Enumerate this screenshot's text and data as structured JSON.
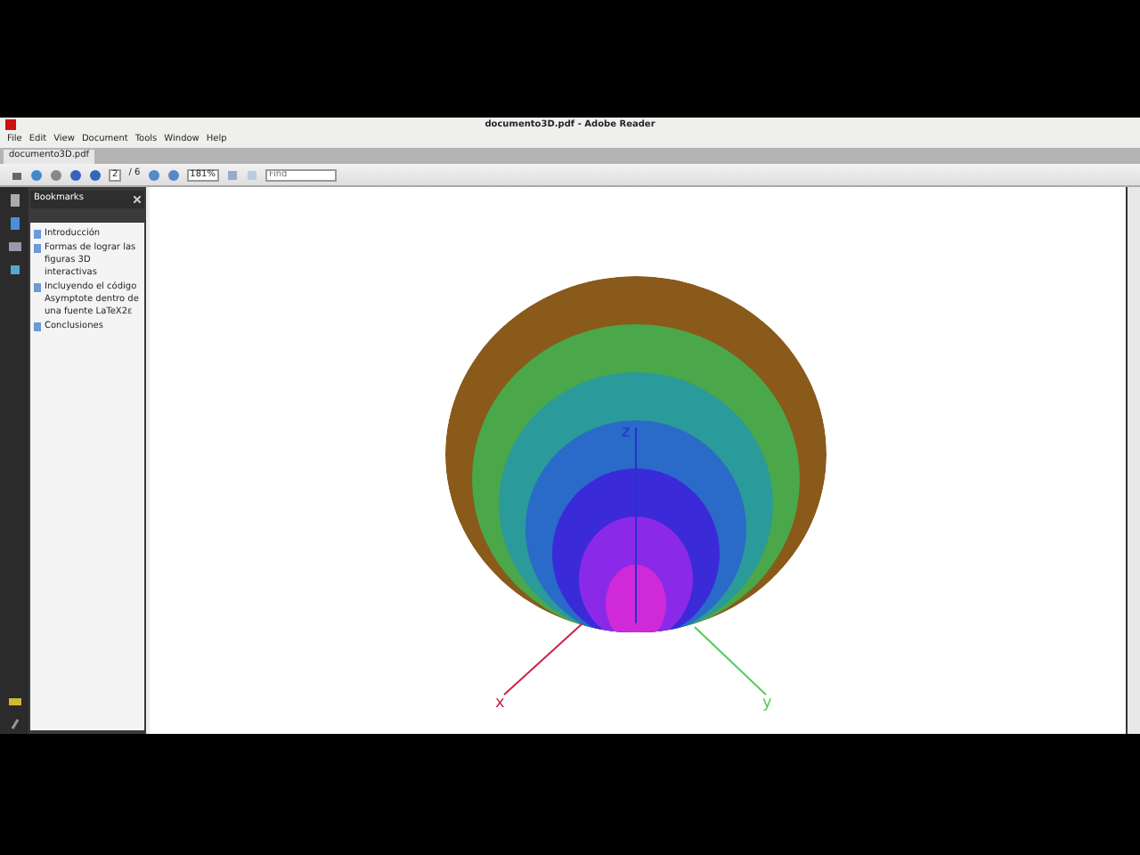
{
  "window": {
    "title": "documento3D.pdf - Adobe Reader"
  },
  "menu": [
    "File",
    "Edit",
    "View",
    "Document",
    "Tools",
    "Window",
    "Help"
  ],
  "tabs": [
    {
      "label": "documento3D.pdf",
      "selected": true
    }
  ],
  "toolbar": {
    "page": "2",
    "page_total": "/ 6",
    "zoom": "181%",
    "find_placeholder": "Find"
  },
  "bookmarks": {
    "title": "Bookmarks",
    "items": [
      {
        "label": "Introducción"
      },
      {
        "label": "Formas de lograr las figuras 3D interactivas"
      },
      {
        "label": "Incluyendo el código Asymptote dentro de una fuente LaTeX2ε"
      },
      {
        "label": "Conclusiones"
      }
    ]
  },
  "axes": {
    "z": "z",
    "x": "x",
    "y": "y"
  }
}
